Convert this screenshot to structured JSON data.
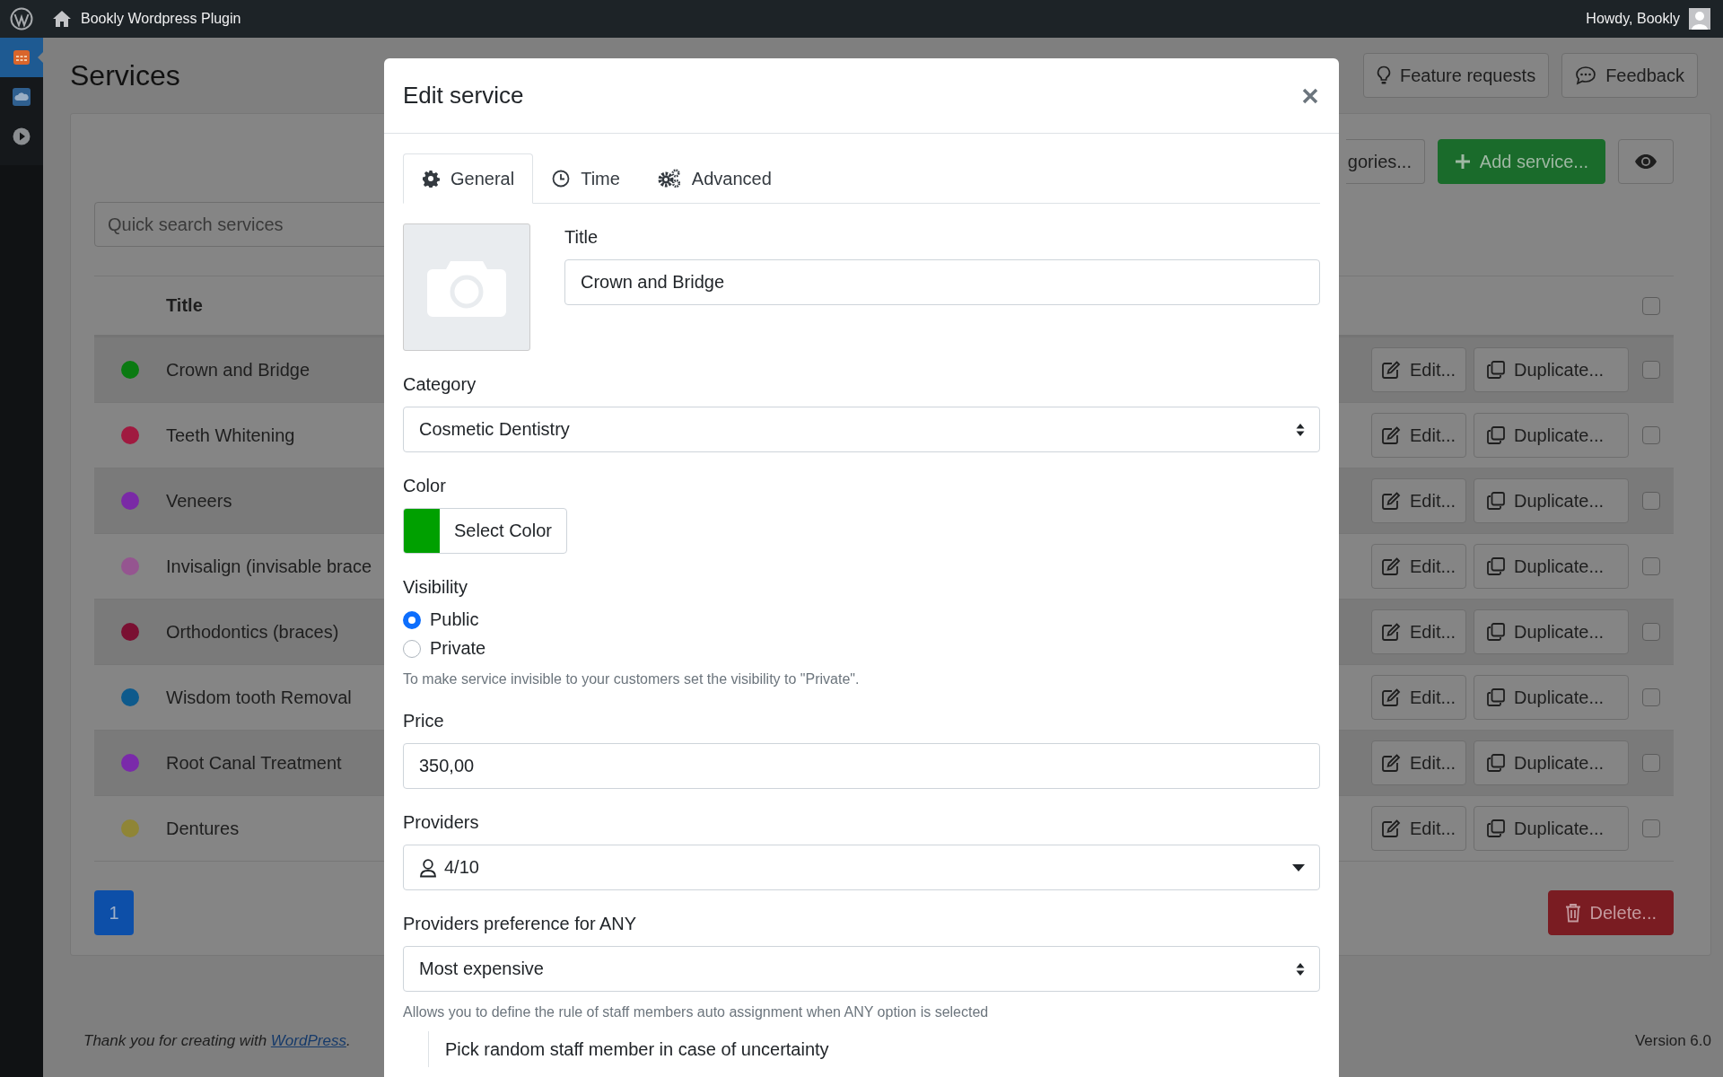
{
  "admin_bar": {
    "site_name": "Bookly Wordpress Plugin",
    "greeting": "Howdy, Bookly"
  },
  "sidebar": {
    "items": [
      {
        "selected": true
      },
      {
        "selected": false
      },
      {
        "selected": false
      }
    ]
  },
  "page": {
    "title": "Services",
    "header_buttons": [
      {
        "label": "Feature requests",
        "kind": "idea"
      },
      {
        "label": "Feedback",
        "kind": "chat"
      }
    ]
  },
  "toolbar": {
    "search": {
      "placeholder": "Quick search services"
    },
    "buttons": [
      {
        "label": "gories...",
        "kind": "plain"
      },
      {
        "label": "Add service...",
        "kind": "add"
      },
      {
        "kind": "preview"
      }
    ]
  },
  "table": {
    "columns": [
      "Title"
    ],
    "select_all_checked": false,
    "rows": [
      {
        "title": "Crown and Bridge",
        "color": "#0b7a12",
        "actions": [
          "Edit...",
          "Duplicate..."
        ],
        "checked": false
      },
      {
        "title": "Teeth Whitening",
        "color": "#a01a40",
        "actions": [
          "Edit...",
          "Duplicate..."
        ],
        "checked": false
      },
      {
        "title": "Veneers",
        "color": "#7a2aa6",
        "actions": [
          "Edit...",
          "Duplicate..."
        ],
        "checked": false
      },
      {
        "title": "Invisalign (invisable brace",
        "color": "#955590",
        "actions": [
          "Edit...",
          "Duplicate..."
        ],
        "checked": false
      },
      {
        "title": "Orthodontics (braces)",
        "color": "#7a1032",
        "actions": [
          "Edit...",
          "Duplicate..."
        ],
        "checked": false
      },
      {
        "title": "Wisdom tooth Removal",
        "color": "#0e5a8c",
        "actions": [
          "Edit...",
          "Duplicate..."
        ],
        "checked": false
      },
      {
        "title": "Root Canal Treatment",
        "color": "#7a2aaa",
        "actions": [
          "Edit...",
          "Duplicate..."
        ],
        "checked": false
      },
      {
        "title": "Dentures",
        "color": "#8f8536",
        "actions": [
          "Edit...",
          "Duplicate..."
        ],
        "checked": false
      }
    ]
  },
  "pagination": [
    {
      "label": "1",
      "selected": true
    }
  ],
  "delete_button": "Delete...",
  "footer": {
    "text_before": "Thank you for creating with ",
    "link": "WordPress",
    "text_after": ".",
    "version": "Version 6.0"
  },
  "modal": {
    "title": "Edit service",
    "tabs": [
      {
        "label": "General",
        "kind": "general",
        "selected": true
      },
      {
        "label": "Time",
        "kind": "time",
        "selected": false
      },
      {
        "label": "Advanced",
        "kind": "advanced",
        "selected": false
      }
    ],
    "title_field": {
      "label": "Title",
      "value": "Crown and Bridge"
    },
    "fields": [
      {
        "kind": "select",
        "label": "Category",
        "value": "Cosmetic Dentistry"
      },
      {
        "kind": "color",
        "label": "Color",
        "button": "Select Color",
        "color": "#00a000"
      },
      {
        "kind": "radio",
        "label": "Visibility",
        "options": [
          {
            "label": "Public",
            "selected": true
          },
          {
            "label": "Private",
            "selected": false
          }
        ],
        "help": "To make service invisible to your customers set the visibility to \"Private\"."
      },
      {
        "kind": "text",
        "label": "Price",
        "value": "350,00"
      },
      {
        "kind": "dropdown",
        "label": "Providers",
        "value": "4/10"
      },
      {
        "kind": "select",
        "label": "Providers preference for ANY",
        "value": "Most expensive",
        "help": "Allows you to define the rule of staff members auto assignment when ANY option is selected"
      },
      {
        "kind": "option",
        "label": "Pick random staff member in case of uncertainty"
      }
    ]
  }
}
